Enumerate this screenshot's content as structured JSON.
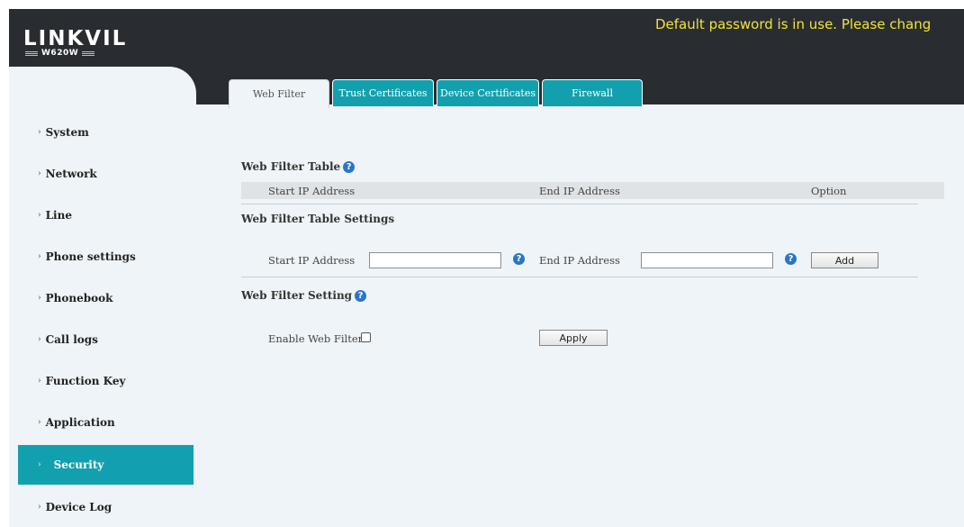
{
  "header": {
    "logo_text": "LINKVIL",
    "model": "W620W",
    "warning": "Default password is in use. Please chang"
  },
  "tabs": [
    {
      "label": "Web Filter",
      "active": true
    },
    {
      "label": "Trust Certificates",
      "active": false
    },
    {
      "label": "Device Certificates",
      "active": false
    },
    {
      "label": "Firewall",
      "active": false
    }
  ],
  "sidebar": {
    "items": [
      {
        "label": "System"
      },
      {
        "label": "Network"
      },
      {
        "label": "Line"
      },
      {
        "label": "Phone settings"
      },
      {
        "label": "Phonebook"
      },
      {
        "label": "Call logs"
      },
      {
        "label": "Function Key"
      },
      {
        "label": "Application"
      },
      {
        "label": "Security",
        "active": true
      },
      {
        "label": "Device Log"
      }
    ]
  },
  "web_filter_table": {
    "title": "Web Filter Table",
    "columns": [
      "Start IP Address",
      "End IP Address",
      "Option"
    ]
  },
  "web_filter_table_settings": {
    "title": "Web Filter Table Settings",
    "start_ip_label": "Start IP Address",
    "start_ip_value": "",
    "end_ip_label": "End IP Address",
    "end_ip_value": "",
    "add_label": "Add"
  },
  "web_filter_setting": {
    "title": "Web Filter Setting",
    "enable_label": "Enable Web Filter",
    "enabled": false,
    "apply_label": "Apply"
  },
  "colors": {
    "accent": "#13a0ae",
    "header_bg": "#292d31",
    "warning": "#f2e23a",
    "content_bg": "#eef4f7",
    "help_icon": "#2a75c9"
  },
  "icons": {
    "help": "question-circle-icon",
    "menu_arrow": "chevron-right-icon"
  }
}
